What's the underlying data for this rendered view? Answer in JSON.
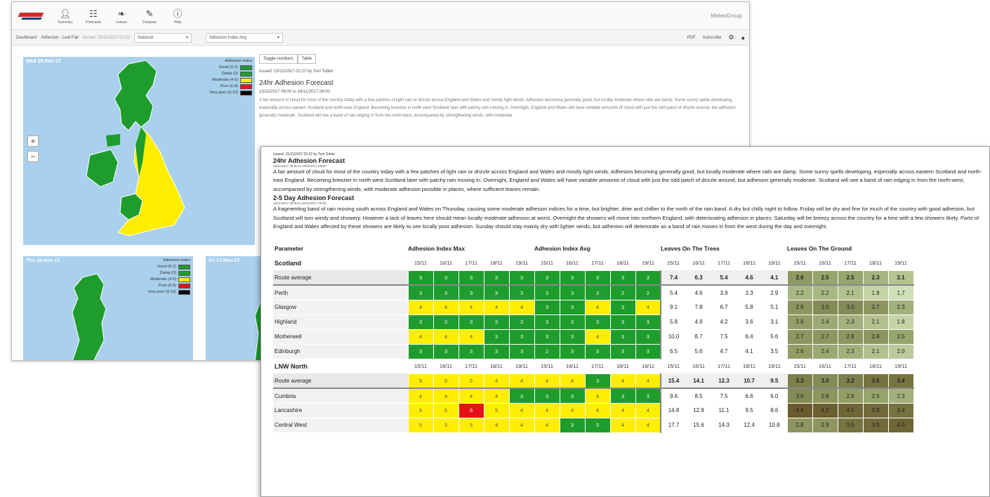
{
  "back_window": {
    "nav": [
      {
        "label": "Summary",
        "icon": "person-icon"
      },
      {
        "label": "Forecasts",
        "icon": "chart-icon"
      },
      {
        "label": "Leaves",
        "icon": "leaf-icon"
      },
      {
        "label": "Compare",
        "icon": "pencil-icon"
      },
      {
        "label": "Help",
        "icon": "info-icon"
      }
    ],
    "brand": "MeteoGroup",
    "subbar": {
      "dashboard": "Dashboard",
      "crumb": "Adhesion - Leaf Fall",
      "issued": "Issued: 15/11/2017 02:22",
      "select1": "National",
      "select2": "Adhesion Index Avg",
      "pdf": "PDF",
      "subscribe": "Subscribe"
    },
    "maps": [
      {
        "date": "Wed 15-Nov-17"
      },
      {
        "date": "Thu 16-Nov-17"
      },
      {
        "date": "Fri 17-Nov-17"
      }
    ],
    "legend": {
      "title": "Adhesion Index",
      "items": [
        {
          "label": "Good (0-2)",
          "color": "#1e9d2d"
        },
        {
          "label": "Damp (3)",
          "color": "#1e9d2d"
        },
        {
          "label": "Moderate (4-5)",
          "color": "#ffee00"
        },
        {
          "label": "Poor (6-8)",
          "color": "#e6121a"
        },
        {
          "label": "Very poor (9-10)",
          "color": "#000000"
        }
      ]
    },
    "toggle_label": "Toggle numbers",
    "table_label": "Table",
    "issued_by": "Issued: 15/11/2017 02:22 by Toni Tobler",
    "title": "24hr Adhesion Forecast",
    "dates": "15/11/2017 06:00 to 16/11/2017 06:00",
    "text": "A fair amount of cloud for most of the country today with a few patches of light rain or drizzle across England and Wales and mostly light winds. Adhesion becoming generally good, but locally moderate where rails are damp. Some sunny spells developing, especially across eastern Scotland and north-east England. Becoming breezier in north west Scotland later with patchy rain moving in. Overnight, England and Wales will have variable amounts of cloud with just the odd patch of drizzle around, but adhesion generally moderate. Scotland will see a band of rain edging in from the north-west, accompanied by strengthening winds, with moderate"
  },
  "front_window": {
    "issued": "Issued: 15/11/2017 02:22 by Toni Tobler",
    "fc24_title": "24hr Adhesion Forecast",
    "fc24_dates": "15/11/2017 06:00 to 16/11/2017 06:00",
    "fc24_text": "A fair amount of cloud for most of the country today with a few patches of light rain or drizzle across England and Wales and mostly light winds. Adhesion becoming generally good, but locally moderate where rails are damp. Some sunny spells developing, especially across eastern Scotland and north-east England. Becoming breezier in north west Scotland later with patchy rain moving in. Overnight, England and Wales will have variable amounts of cloud with just the odd patch of drizzle around, but adhesion generally moderate. Scotland will see a band of rain edging in from the north-west, accompanied by strengthening winds, with moderate adhesion possible in places, where sufficient leaves remain.",
    "fc25_title": "2-5 Day Adhesion Forecast",
    "fc25_dates": "16/11/2017 06:00 to 20/11/2017 06:00",
    "fc25_text": "A fragmenting band of rain moving south across England and Wales on Thursday, causing some moderate adhesion indices for a time, but brighter, drier and chillier to the north of the rain band. A dry but chilly night to follow. Friday will be dry and fine for much of the country with good adhesion, but Scotland will turn windy and showery. However a lack of leaves here should mean locally moderate adhesion at worst. Overnight the showers will move into northern England, with deteriorating adhesion in places. Saturday will be breezy across the country for a time with a few showers likely. Parts of England and Wales affected by these showers are likely to see locally poor adhesion. Sunday should stay mainly dry with lighter winds, but adhesion will deteriorate as a band of rain moves in from the west during the day and overnight.",
    "table": {
      "param_header": "Parameter",
      "groups": [
        "Adhesion Index Max",
        "Adhesion Index Avg",
        "Leaves On The Trees",
        "Leaves On The Ground"
      ],
      "dates": [
        "15/11",
        "16/11",
        "17/11",
        "18/11",
        "19/11"
      ],
      "sections": [
        {
          "name": "Scotland",
          "rows": [
            {
              "name": "Route average",
              "avg": true,
              "max": [
                "3",
                "3",
                "3",
                "3",
                "3"
              ],
              "maxc": [
                "g",
                "g",
                "g",
                "g",
                "g"
              ],
              "avgv": [
                "3",
                "3",
                "3",
                "3",
                "3"
              ],
              "avgc": [
                "g",
                "g",
                "g",
                "g",
                "g"
              ],
              "trees": [
                "7.4",
                "6.3",
                "5.4",
                "4.6",
                "4.1"
              ],
              "ground": [
                "2.6",
                "2.5",
                "2.5",
                "2.3",
                "2.1"
              ],
              "gc": [
                "#8f9a63",
                "#97a46b",
                "#97a46b",
                "#a7b481",
                "#b6c390"
              ]
            },
            {
              "name": "Perth",
              "max": [
                "3",
                "3",
                "3",
                "3",
                "3"
              ],
              "maxc": [
                "g",
                "g",
                "g",
                "g",
                "g"
              ],
              "avgv": [
                "3",
                "3",
                "3",
                "2",
                "2"
              ],
              "avgc": [
                "g",
                "g",
                "g",
                "g",
                "g"
              ],
              "trees": [
                "5.4",
                "4.6",
                "3.9",
                "3.3",
                "2.9"
              ],
              "ground": [
                "2.2",
                "2.2",
                "2.1",
                "1.9",
                "1.7"
              ],
              "gc": [
                "#a9b783",
                "#a9b783",
                "#b3c08e",
                "#c6d3a7",
                "#cfe0b8"
              ]
            },
            {
              "name": "Glasgow",
              "max": [
                "4",
                "4",
                "4",
                "4",
                "4"
              ],
              "maxc": [
                "y",
                "y",
                "y",
                "y",
                "y"
              ],
              "avgv": [
                "3",
                "3",
                "4",
                "3",
                "4"
              ],
              "avgc": [
                "g",
                "g",
                "y",
                "g",
                "y"
              ],
              "trees": [
                "9.1",
                "7.8",
                "6.7",
                "5.8",
                "5.1"
              ],
              "ground": [
                "2.8",
                "3.0",
                "3.0",
                "2.7",
                "2.3"
              ],
              "gc": [
                "#8e9560",
                "#848b56",
                "#848b56",
                "#8e9560",
                "#a4b07b"
              ]
            },
            {
              "name": "Highland",
              "max": [
                "3",
                "3",
                "3",
                "3",
                "3"
              ],
              "maxc": [
                "g",
                "g",
                "g",
                "g",
                "g"
              ],
              "avgv": [
                "3",
                "3",
                "3",
                "3",
                "3"
              ],
              "avgc": [
                "g",
                "g",
                "g",
                "g",
                "g"
              ],
              "trees": [
                "5.8",
                "4.9",
                "4.2",
                "3.6",
                "3.1"
              ],
              "ground": [
                "2.6",
                "2.4",
                "2.3",
                "2.1",
                "1.8"
              ],
              "gc": [
                "#939e67",
                "#9ca974",
                "#a4b07b",
                "#b3c08e",
                "#c6d3a7"
              ]
            },
            {
              "name": "Motherwell",
              "max": [
                "4",
                "4",
                "4",
                "3",
                "3"
              ],
              "maxc": [
                "y",
                "y",
                "y",
                "g",
                "g"
              ],
              "avgv": [
                "3",
                "3",
                "4",
                "3",
                "3"
              ],
              "avgc": [
                "g",
                "g",
                "y",
                "g",
                "g"
              ],
              "trees": [
                "10.0",
                "8.7",
                "7.5",
                "6.4",
                "5.6"
              ],
              "ground": [
                "2.7",
                "2.7",
                "2.8",
                "2.8",
                "2.5"
              ],
              "gc": [
                "#8e9560",
                "#8e9560",
                "#8e9560",
                "#8e9560",
                "#97a46b"
              ]
            },
            {
              "name": "Edinburgh",
              "max": [
                "3",
                "3",
                "3",
                "3",
                "3"
              ],
              "maxc": [
                "g",
                "g",
                "g",
                "g",
                "g"
              ],
              "avgv": [
                "2",
                "3",
                "3",
                "3",
                "3"
              ],
              "avgc": [
                "g",
                "g",
                "g",
                "g",
                "g"
              ],
              "trees": [
                "6.5",
                "5.6",
                "4.7",
                "4.1",
                "3.5"
              ],
              "ground": [
                "2.6",
                "2.4",
                "2.3",
                "2.1",
                "2.0"
              ],
              "gc": [
                "#939e67",
                "#9ca974",
                "#a4b07b",
                "#b3c08e",
                "#bcc99c"
              ]
            }
          ]
        },
        {
          "name": "LNW North",
          "rows": [
            {
              "name": "Route average",
              "avg": true,
              "max": [
                "5",
                "5",
                "5",
                "4",
                "4"
              ],
              "maxc": [
                "y",
                "y",
                "y",
                "y",
                "y"
              ],
              "avgv": [
                "4",
                "4",
                "3",
                "4",
                "4"
              ],
              "avgc": [
                "y",
                "y",
                "g",
                "y",
                "y"
              ],
              "trees": [
                "15.4",
                "14.1",
                "12.3",
                "10.7",
                "9.5"
              ],
              "ground": [
                "3.3",
                "3.0",
                "3.2",
                "3.5",
                "3.4"
              ],
              "gc": [
                "#7d7f4d",
                "#848b56",
                "#7d7f4d",
                "#76733f",
                "#76733f"
              ]
            },
            {
              "name": "Cumbria",
              "max": [
                "4",
                "4",
                "4",
                "4",
                "3"
              ],
              "maxc": [
                "y",
                "y",
                "y",
                "y",
                "g"
              ],
              "avgv": [
                "3",
                "3",
                "4",
                "3",
                "3"
              ],
              "avgc": [
                "g",
                "g",
                "y",
                "g",
                "g"
              ],
              "trees": [
                "9.6",
                "8.5",
                "7.5",
                "6.6",
                "6.0"
              ],
              "ground": [
                "3.0",
                "2.8",
                "2.6",
                "2.5",
                "2.3"
              ],
              "gc": [
                "#848b56",
                "#8e9560",
                "#939e67",
                "#97a46b",
                "#a4b07b"
              ]
            },
            {
              "name": "Lancashire",
              "max": [
                "5",
                "5",
                "6",
                "5",
                "4"
              ],
              "maxc": [
                "y",
                "y",
                "r",
                "y",
                "y"
              ],
              "avgv": [
                "4",
                "4",
                "4",
                "4",
                "4"
              ],
              "avgc": [
                "y",
                "y",
                "y",
                "y",
                "y"
              ],
              "trees": [
                "14.8",
                "12.9",
                "11.1",
                "9.5",
                "8.6"
              ],
              "ground": [
                "4.4",
                "4.2",
                "4.0",
                "3.8",
                "3.4"
              ],
              "gc": [
                "#6b5a2b",
                "#6b5f30",
                "#706535",
                "#736a3a",
                "#76733f"
              ]
            },
            {
              "name": "Central West",
              "max": [
                "5",
                "5",
                "5",
                "4",
                "4"
              ],
              "maxc": [
                "y",
                "y",
                "y",
                "y",
                "y"
              ],
              "avgv": [
                "4",
                "3",
                "3",
                "4",
                "4"
              ],
              "avgc": [
                "y",
                "g",
                "g",
                "y",
                "y"
              ],
              "trees": [
                "17.7",
                "15.6",
                "14.3",
                "12.4",
                "10.8"
              ],
              "ground": [
                "2.8",
                "2.9",
                "3.5",
                "3.9",
                "4.0"
              ],
              "gc": [
                "#8e9560",
                "#8e9560",
                "#76733f",
                "#736a3a",
                "#706535"
              ]
            }
          ]
        }
      ]
    }
  }
}
